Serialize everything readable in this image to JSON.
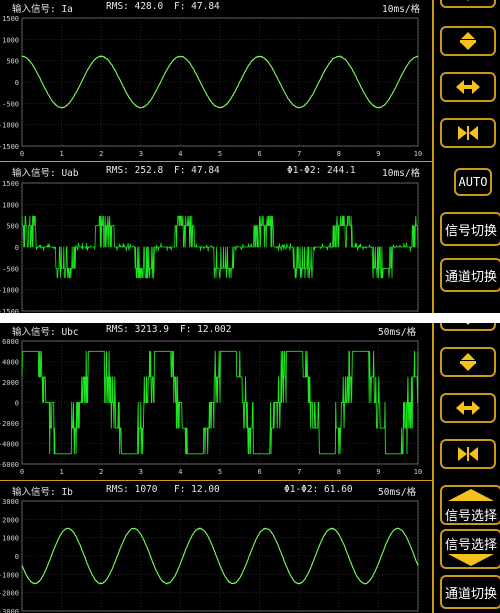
{
  "top_view": {
    "panels": [
      {
        "input_label": "输入信号: Ia",
        "rms": "RMS: 428.0",
        "freq": "F: 47.84",
        "phase": "",
        "timebase": "10ms/格",
        "chart_data": {
          "type": "line",
          "x": [
            0,
            1,
            2,
            3,
            4,
            5,
            6,
            7,
            8,
            9,
            10
          ],
          "xticks": [
            "0",
            "1",
            "2",
            "3",
            "4",
            "5",
            "6",
            "7",
            "8",
            "9",
            "10"
          ],
          "xlim": [
            0,
            10
          ],
          "ylim": [
            -1500,
            1500
          ],
          "yticks": [
            "1500",
            "1000",
            "500",
            "0",
            "-500",
            "-1000",
            "-1500"
          ],
          "series": [
            {
              "waveform": "sine",
              "amplitude": 600,
              "cycles_across_axis": 5,
              "start_phase_deg": 90,
              "color": "#7CFC5A"
            }
          ]
        }
      },
      {
        "input_label": "输入信号: Uab",
        "rms": "RMS: 252.8",
        "freq": "F: 47.84",
        "phase": "Φ1-Φ2: 244.1",
        "timebase": "10ms/格",
        "chart_data": {
          "type": "line",
          "xlim": [
            0,
            10
          ],
          "ylim": [
            -1500,
            1500
          ],
          "yticks": [
            "1500",
            "1000",
            "500",
            "0",
            "-500",
            "-1000",
            "-1500"
          ],
          "series": [
            {
              "waveform": "pwm-stepped",
              "step_levels": [
                500,
                0,
                -500,
                0
              ],
              "spike_peak": 750,
              "cycles_across_axis": 5,
              "color": "#1EE61E"
            }
          ]
        }
      }
    ],
    "buttons": {
      "expand_vertical_icon": "expand-vertical-icon",
      "expand_horizontal_icon": "expand-horizontal-icon",
      "compress_horizontal_icon": "compress-horizontal-icon",
      "auto_label": "AUTO",
      "signal_switch_label": "信号切换",
      "channel_switch_label": "通道切换"
    }
  },
  "bottom_view": {
    "panels": [
      {
        "input_label": "输入信号: Ubc",
        "rms": "RMS: 3213.9",
        "freq": "F: 12.002",
        "phase": "",
        "timebase": "50ms/格",
        "chart_data": {
          "type": "line",
          "x": [
            0,
            1,
            2,
            3,
            4,
            5,
            6,
            7,
            8,
            9,
            10
          ],
          "xticks": [
            "0",
            "1",
            "2",
            "3",
            "4",
            "5",
            "6",
            "7",
            "8",
            "9",
            "10"
          ],
          "xlim": [
            0,
            10
          ],
          "ylim": [
            -6000,
            6000
          ],
          "yticks": [
            "6000",
            "4000",
            "2000",
            "0",
            "-2000",
            "-4000",
            "-6000"
          ],
          "series": [
            {
              "waveform": "stepped-six-step",
              "step_levels": [
                5000,
                2500,
                0,
                -2500,
                -5000
              ],
              "cycles_across_axis": 6,
              "color": "#1EE61E"
            }
          ]
        }
      },
      {
        "input_label": "输入信号: Ib",
        "rms": "RMS: 1070",
        "freq": "F: 12.00",
        "phase": "Φ1-Φ2: 61.60",
        "timebase": "50ms/格",
        "chart_data": {
          "type": "line",
          "xlim": [
            0,
            10
          ],
          "ylim": [
            -3000,
            3000
          ],
          "yticks": [
            "3000",
            "2000",
            "1000",
            "0",
            "-1000",
            "-2000",
            "-3000"
          ],
          "series": [
            {
              "waveform": "sine",
              "amplitude": 1500,
              "cycles_across_axis": 6,
              "start_phase_deg": 200,
              "color": "#7CFC5A"
            }
          ]
        }
      }
    ],
    "buttons": {
      "expand_vertical_icon": "expand-vertical-icon",
      "expand_horizontal_icon": "expand-horizontal-icon",
      "compress_horizontal_icon": "compress-horizontal-icon",
      "signal_select_up_label": "信号选择",
      "signal_select_down_label": "信号选择",
      "channel_switch_label": "通道切换"
    }
  },
  "colors": {
    "accent": "#C89A18",
    "trace_light": "#7CFC5A",
    "trace_bright": "#1EE61E",
    "button_yellow": "#F5C21B"
  }
}
